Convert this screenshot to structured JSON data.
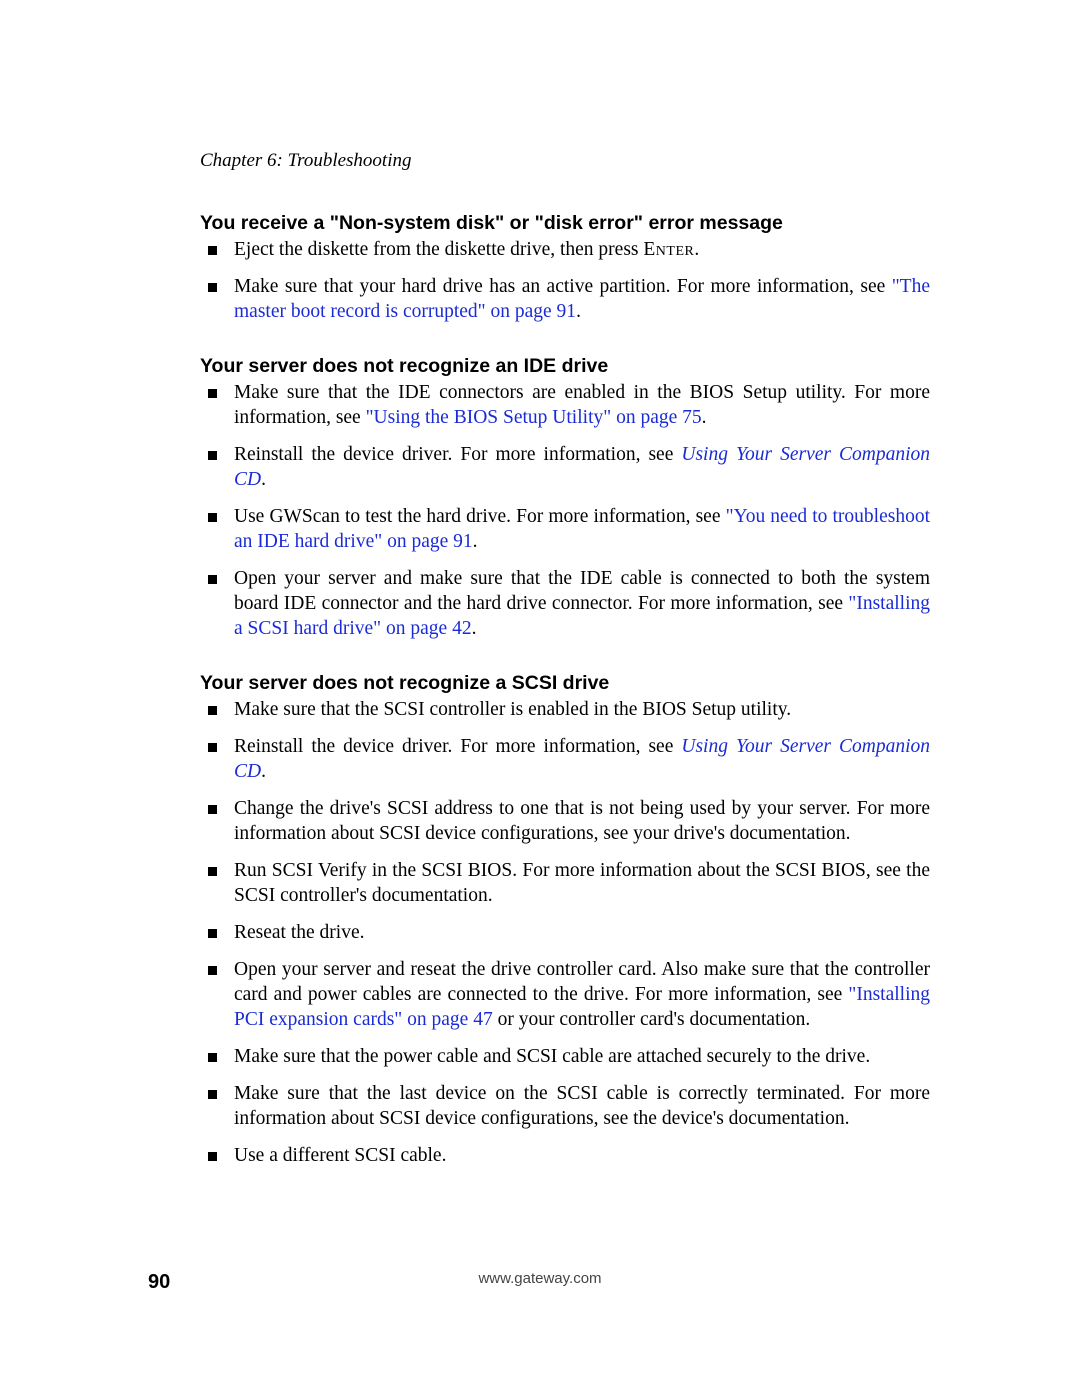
{
  "chapter": "Chapter 6: Troubleshooting",
  "sections": [
    {
      "heading": "You receive a \"Non-system disk\" or \"disk error\" error message",
      "items": [
        {
          "parts": [
            {
              "t": "Eject the diskette from the diskette drive, then press "
            },
            {
              "t": "Enter",
              "style": "smallcaps"
            },
            {
              "t": "."
            }
          ]
        },
        {
          "parts": [
            {
              "t": "Make sure that your hard drive has an active partition. For more information, see "
            },
            {
              "t": "\"The master boot record is corrupted\" on page 91",
              "style": "link"
            },
            {
              "t": "."
            }
          ]
        }
      ]
    },
    {
      "heading": "Your server does not recognize an IDE drive",
      "items": [
        {
          "parts": [
            {
              "t": "Make sure that the IDE connectors are enabled in the BIOS Setup utility. For more information, see "
            },
            {
              "t": "\"Using the BIOS Setup Utility\" on page 75",
              "style": "link"
            },
            {
              "t": "."
            }
          ]
        },
        {
          "parts": [
            {
              "t": "Reinstall the device driver. For more information, see "
            },
            {
              "t": "Using Your Server Companion CD",
              "style": "link-italic"
            },
            {
              "t": "."
            }
          ]
        },
        {
          "parts": [
            {
              "t": "Use GWScan to test the hard drive. For more information, see "
            },
            {
              "t": "\"You need to troubleshoot an IDE hard drive\" on page 91",
              "style": "link"
            },
            {
              "t": "."
            }
          ]
        },
        {
          "parts": [
            {
              "t": "Open your server and make sure that the IDE cable is connected to both the system board IDE connector and the hard drive connector. For more information, see "
            },
            {
              "t": "\"Installing a SCSI hard drive\" on page 42",
              "style": "link"
            },
            {
              "t": "."
            }
          ]
        }
      ]
    },
    {
      "heading": "Your server does not recognize a SCSI drive",
      "items": [
        {
          "parts": [
            {
              "t": "Make sure that the SCSI controller is enabled in the BIOS Setup utility."
            }
          ]
        },
        {
          "parts": [
            {
              "t": "Reinstall the device driver. For more information, see "
            },
            {
              "t": "Using Your Server Companion CD",
              "style": "link-italic"
            },
            {
              "t": "."
            }
          ]
        },
        {
          "parts": [
            {
              "t": "Change the drive's SCSI address to one that is not being used by your server. For more information about SCSI device configurations, see your drive's documentation."
            }
          ]
        },
        {
          "parts": [
            {
              "t": "Run SCSI Verify in the SCSI BIOS. For more information about the SCSI BIOS, see the SCSI controller's documentation."
            }
          ]
        },
        {
          "parts": [
            {
              "t": "Reseat the drive."
            }
          ]
        },
        {
          "parts": [
            {
              "t": "Open your server and reseat the drive controller card. Also make sure that the controller card and power cables are connected to the drive. For more information, see "
            },
            {
              "t": "\"Installing PCI expansion cards\" on page 47",
              "style": "link"
            },
            {
              "t": " or your controller card's documentation."
            }
          ]
        },
        {
          "parts": [
            {
              "t": "Make sure that the power cable and SCSI cable are attached securely to the drive."
            }
          ]
        },
        {
          "parts": [
            {
              "t": "Make sure that the last device on the SCSI cable is correctly terminated. For more information about SCSI device configurations, see the device's documentation."
            }
          ]
        },
        {
          "parts": [
            {
              "t": "Use a different SCSI cable."
            }
          ]
        }
      ]
    }
  ],
  "footer_url": "www.gateway.com",
  "page_number": "90"
}
